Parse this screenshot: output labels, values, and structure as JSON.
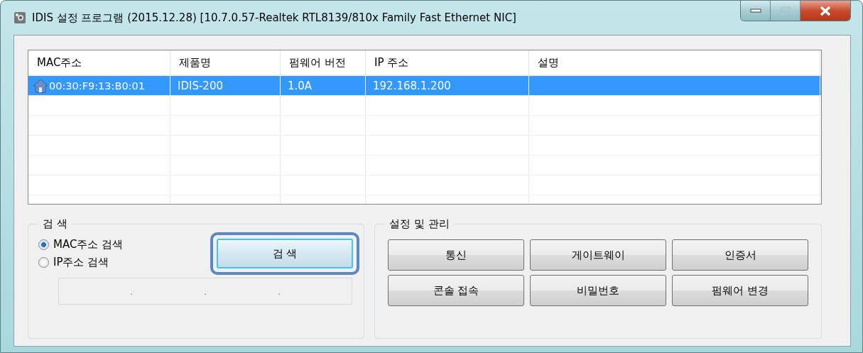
{
  "window": {
    "title": "IDIS 설정 프로그램 (2015.12.28) [10.7.0.57-Realtek RTL8139/810x Family Fast Ethernet NIC]",
    "maximize_disabled": true
  },
  "table": {
    "columns": [
      "MAC주소",
      "제품명",
      "펌웨어 버전",
      "IP 주소",
      "설명"
    ],
    "rows": [
      {
        "cells": [
          "00:30:F9:13:B0:01",
          "IDIS-200",
          "1.0A",
          "192.168.1.200",
          ""
        ],
        "selected": true
      }
    ]
  },
  "search": {
    "title": "검 색",
    "options": [
      {
        "label": "MAC주소 검색",
        "selected": true
      },
      {
        "label": "IP주소 검색",
        "selected": false
      }
    ],
    "ip_separators": [
      ".",
      ".",
      "."
    ],
    "button": {
      "label": "검 색",
      "focused": true
    }
  },
  "management": {
    "title": "설정 및 관리",
    "buttons": [
      "통신",
      "게이트웨이",
      "인증서",
      "콘솔 접속",
      "비밀번호",
      "펌웨어 변경"
    ]
  }
}
